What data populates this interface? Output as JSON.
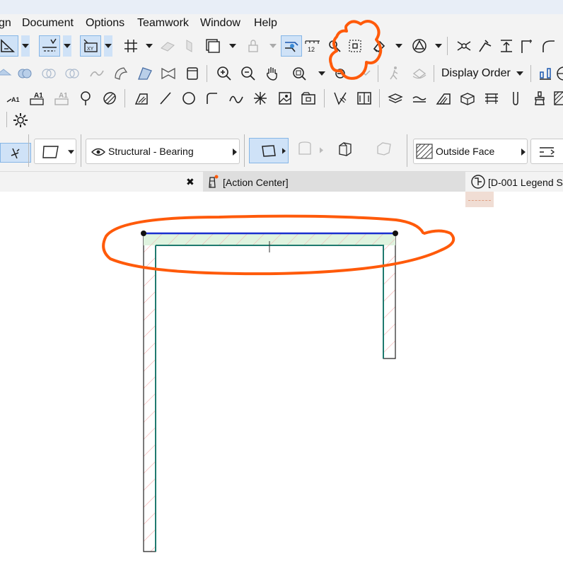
{
  "menu": {
    "items": [
      "gn",
      "Document",
      "Options",
      "Teamwork",
      "Window",
      "Help"
    ]
  },
  "toolbar": {
    "display_order_label": "Display Order"
  },
  "infobox": {
    "layer_label": "Structural - Bearing",
    "surface_label": "Outside Face"
  },
  "tabs": {
    "close_glyph": "✖",
    "action_center": "[Action Center]",
    "legend": "[D-001 Legend Sy"
  },
  "colors": {
    "chrome": "#f3f3f3",
    "accent_active": "#cfe2f7",
    "wall_reference_line": "#1a2fd0",
    "wall_fill_selected": "#dff3df",
    "wall_hatch": "#f0a0a0",
    "annotation_orange": "#ff5a0a"
  }
}
